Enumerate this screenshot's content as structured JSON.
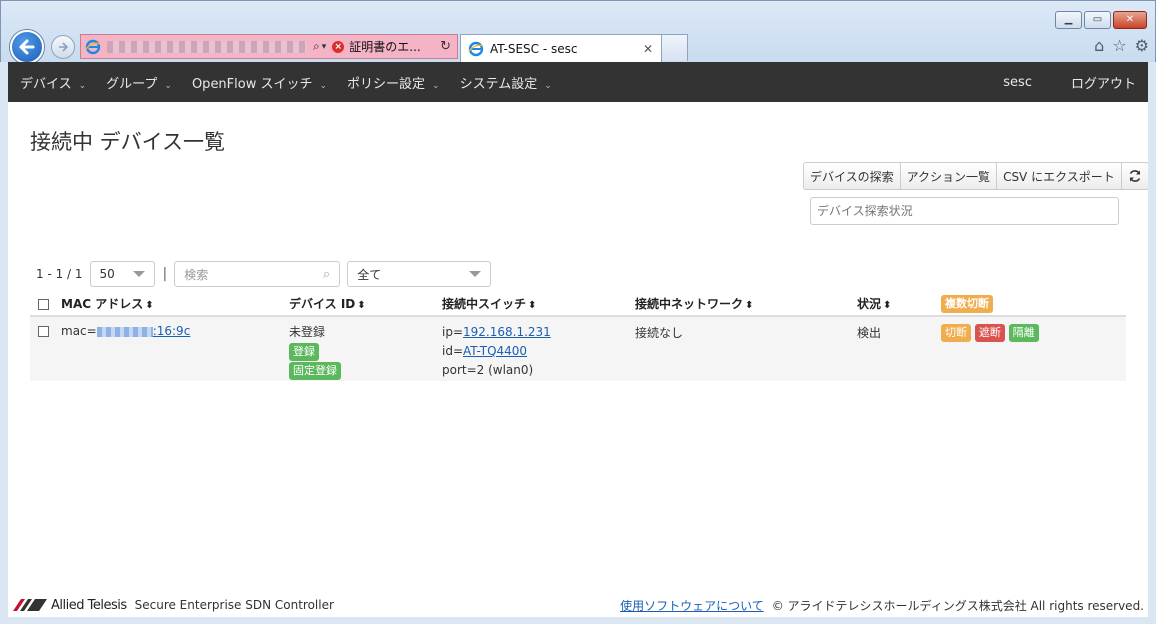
{
  "browser": {
    "tab_title": "AT-SESC - sesc",
    "cert_error": "証明書のエ...",
    "window_buttons": [
      "minimize",
      "maximize",
      "close"
    ]
  },
  "navbar": {
    "items": [
      {
        "label": "デバイス"
      },
      {
        "label": "グループ"
      },
      {
        "label": "OpenFlow スイッチ"
      },
      {
        "label": "ポリシー設定"
      },
      {
        "label": "システム設定"
      }
    ],
    "user": "sesc",
    "logout": "ログアウト"
  },
  "page": {
    "title": "接続中 デバイス一覧"
  },
  "toolbar": {
    "discover": "デバイスの探索",
    "actions": "アクション一覧",
    "export_csv": "CSV にエクスポート",
    "refresh_icon": "refresh-icon",
    "status_placeholder": "デバイス探索状況"
  },
  "pager": {
    "range": "1 - 1 / 1",
    "per_page": "50",
    "separator": "|",
    "search_placeholder": "検索",
    "filter": "全て"
  },
  "table": {
    "headers": {
      "mac": "MAC アドレス",
      "device_id": "デバイス ID",
      "switch": "接続中スイッチ",
      "network": "接続中ネットワーク",
      "status": "状況",
      "bulk_disconnect": "複数切断"
    },
    "rows": [
      {
        "mac_prefix": "mac=",
        "mac_suffix": ":16:9c",
        "device_id": "未登録",
        "register": "登録",
        "fixed_register": "固定登録",
        "ip_prefix": "ip=",
        "ip": "192.168.1.231",
        "id_prefix": "id=",
        "switch_id": "AT-TQ4400",
        "port": "port=2 (wlan0)",
        "network": "接続なし",
        "status": "検出",
        "action_disconnect": "切断",
        "action_block": "遮断",
        "action_isolate": "隔離"
      }
    ]
  },
  "footer": {
    "brand": "Allied Telesis",
    "product": "Secure Enterprise SDN Controller",
    "software_link": "使用ソフトウェアについて",
    "copyright": "© アライドテレシスホールディングス株式会社 All rights reserved."
  },
  "colors": {
    "navbar_bg": "#333333",
    "success": "#5cb85c",
    "warning": "#f0ad4e",
    "danger": "#d9534f",
    "link": "#1a5fb4",
    "address_bar_error": "#f5b3c6"
  }
}
